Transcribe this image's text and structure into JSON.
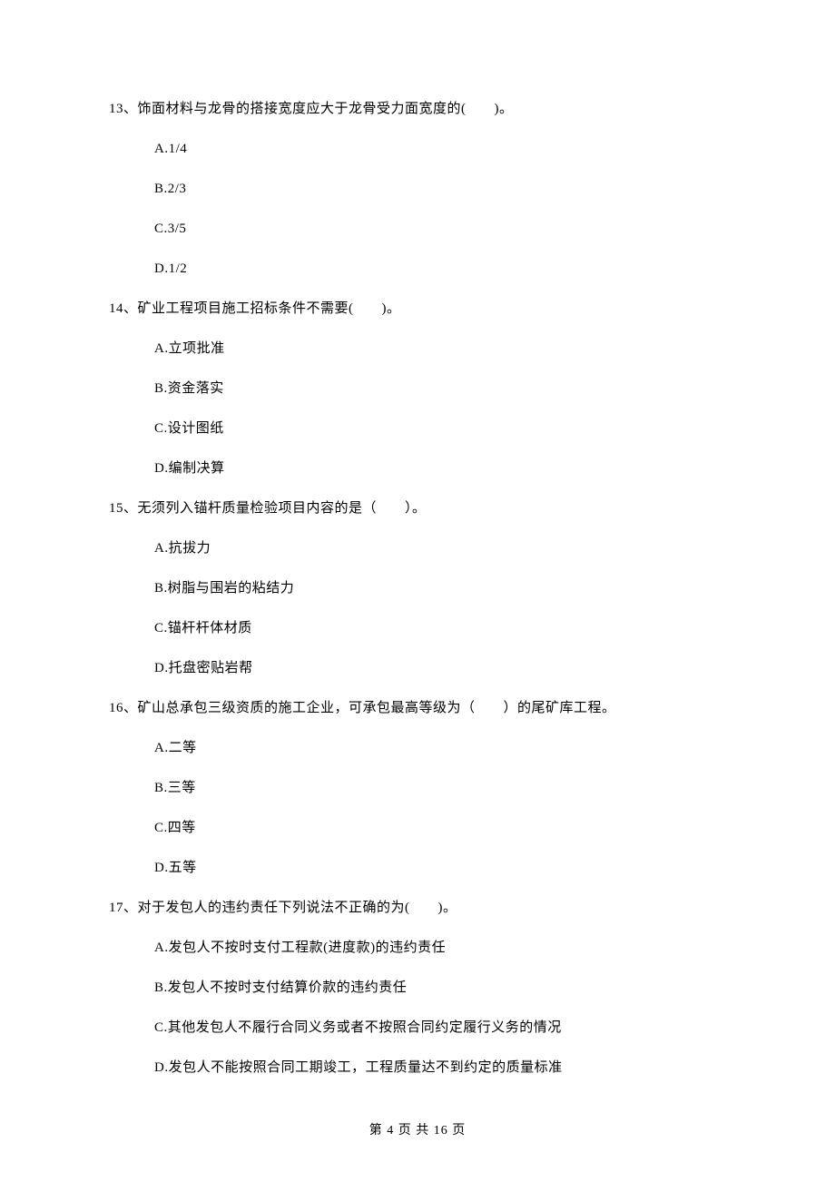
{
  "questions": [
    {
      "number": "13、",
      "stem": "饰面材料与龙骨的搭接宽度应大于龙骨受力面宽度的(　　)。",
      "options": {
        "a": "A.1/4",
        "b": "B.2/3",
        "c": "C.3/5",
        "d": "D.1/2"
      }
    },
    {
      "number": "14、",
      "stem": "矿业工程项目施工招标条件不需要(　　)。",
      "options": {
        "a": "A.立项批准",
        "b": "B.资金落实",
        "c": "C.设计图纸",
        "d": "D.编制决算"
      }
    },
    {
      "number": "15、",
      "stem": "无须列入锚杆质量检验项目内容的是（　　）。",
      "options": {
        "a": "A.抗拔力",
        "b": "B.树脂与围岩的粘结力",
        "c": "C.锚杆杆体材质",
        "d": "D.托盘密贴岩帮"
      }
    },
    {
      "number": "16、",
      "stem": "矿山总承包三级资质的施工企业，可承包最高等级为（　　）的尾矿库工程。",
      "options": {
        "a": "A.二等",
        "b": "B.三等",
        "c": "C.四等",
        "d": "D.五等"
      }
    },
    {
      "number": "17、",
      "stem": "对于发包人的违约责任下列说法不正确的为(　　)。",
      "options": {
        "a": "A.发包人不按时支付工程款(进度款)的违约责任",
        "b": "B.发包人不按时支付结算价款的违约责任",
        "c": "C.其他发包人不履行合同义务或者不按照合同约定履行义务的情况",
        "d": "D.发包人不能按照合同工期竣工，工程质量达不到约定的质量标准"
      }
    }
  ],
  "footer": "第 4 页 共 16 页"
}
